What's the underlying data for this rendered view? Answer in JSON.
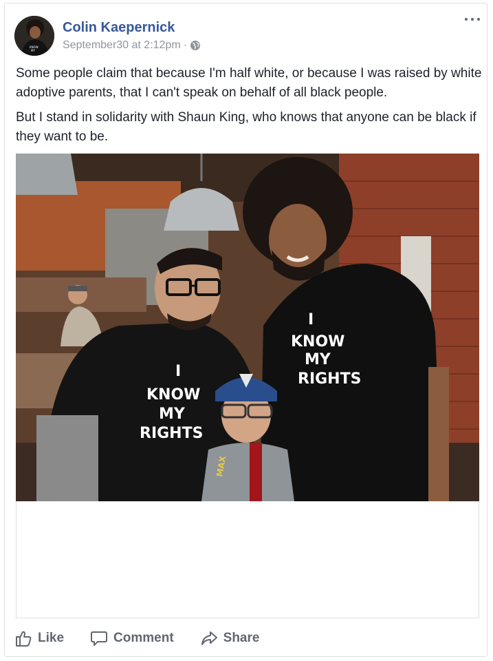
{
  "post": {
    "author": "Colin Kaepernick",
    "timestamp": "September30 at 2:12pm",
    "separator": "·",
    "privacy_icon": "globe-icon",
    "more_icon": "more-options-icon",
    "paragraphs": [
      "Some people claim that because I'm half white, or because I was raised by white adoptive parents, that I can't speak on behalf of all black people.",
      "But I stand in solidarity with Shaun King, who knows that anyone can be black if they want to be."
    ],
    "photo": {
      "shirt_text_left": [
        "I",
        "KNOW",
        "MY",
        "RIGHTS"
      ],
      "shirt_text_right": [
        "I",
        "KNOW",
        "MY",
        "RIGHTS"
      ],
      "kid_shirt_text": "MAX"
    }
  },
  "actions": {
    "like": {
      "label": "Like",
      "icon": "thumbs-up-icon"
    },
    "comment": {
      "label": "Comment",
      "icon": "comment-bubble-icon"
    },
    "share": {
      "label": "Share",
      "icon": "share-arrow-icon"
    }
  },
  "colors": {
    "author_link": "#365899",
    "meta_gray": "#90949c",
    "action_gray": "#606770",
    "border": "#dddfe2"
  }
}
